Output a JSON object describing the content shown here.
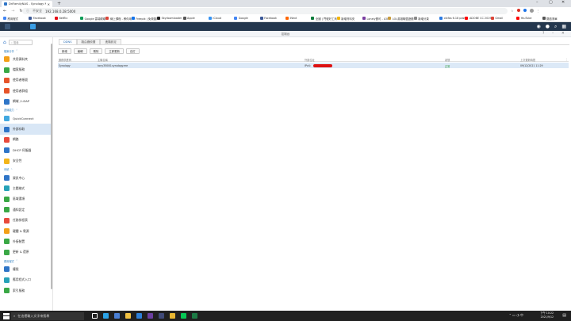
{
  "browser": {
    "tab_title": "DriFamilyNAS - Synology NAS",
    "new_tab": "+",
    "address_security": "不安全",
    "address_url": "192.168.0.28:5000",
    "bookmarks": [
      {
        "label": "應用程式",
        "color": "#4285f4"
      },
      {
        "label": "Facebook",
        "color": "#3b5998"
      },
      {
        "label": "Netflix",
        "color": "#e50914"
      },
      {
        "label": "Google 雲端硬碟",
        "color": "#0f9d58"
      },
      {
        "label": "線上課程 - 教你用...",
        "color": "#db4437"
      },
      {
        "label": "Freepik | 免費圖庫...",
        "color": "#1273eb"
      },
      {
        "label": "Skydownloader / T...",
        "color": "#222222"
      },
      {
        "label": "Apple",
        "color": "#555555"
      },
      {
        "label": "iCloud",
        "color": "#3693f3"
      },
      {
        "label": "Google",
        "color": "#4285f4"
      },
      {
        "label": "Facebook",
        "color": "#3b5998"
      },
      {
        "label": "iNext",
        "color": "#ff6600"
      },
      {
        "label": "全國 | 門號好工商...",
        "color": "#0a7d3b"
      },
      {
        "label": "新增資料夾",
        "color": "#f4b400"
      },
      {
        "label": "Lonely寶可 - LOL...",
        "color": "#7a3ea1"
      },
      {
        "label": "LOL英雄聯盟遊戲...",
        "color": "#c89b3c"
      },
      {
        "label": "新增分頁",
        "color": "#888888"
      },
      {
        "label": "cibfas 6.18 pass...",
        "color": "#2a7ae2"
      },
      {
        "label": "ADOBE CC 2019 f...",
        "color": "#ff0000"
      },
      {
        "label": "Gmail",
        "color": "#db4437"
      },
      {
        "label": "YouTube",
        "color": "#ff0000"
      },
      {
        "label": "閱讀清單",
        "color": "#555555"
      }
    ]
  },
  "window": {
    "title": "控制台"
  },
  "sidebar": {
    "search_placeholder": "搜尋",
    "groups": [
      {
        "label": "檔案分享",
        "items": [
          {
            "label": "共用資料夾",
            "color": "#f3a018",
            "name": "shared-folder"
          },
          {
            "label": "檔案服務",
            "color": "#3aa845",
            "name": "file-services"
          },
          {
            "label": "使用者帳號",
            "color": "#e6542a",
            "name": "user"
          },
          {
            "label": "使用者群組",
            "color": "#e6542a",
            "name": "group"
          },
          {
            "label": "網域 / LDAP",
            "color": "#2f75c7",
            "name": "domain-ldap"
          }
        ]
      },
      {
        "label": "連線能力",
        "items": [
          {
            "label": "QuickConnect",
            "color": "#40a8e0",
            "name": "quickconnect"
          },
          {
            "label": "外部存取",
            "color": "#2f75c7",
            "name": "external-access",
            "selected": true
          },
          {
            "label": "網路",
            "color": "#e84a3c",
            "name": "network"
          },
          {
            "label": "DHCP 伺服器",
            "color": "#2f75c7",
            "name": "dhcp-server"
          },
          {
            "label": "安全性",
            "color": "#f3b51a",
            "name": "security"
          }
        ]
      },
      {
        "label": "系統",
        "items": [
          {
            "label": "資訊中心",
            "color": "#2f75c7",
            "name": "info-center"
          },
          {
            "label": "主題樣式",
            "color": "#27a2b8",
            "name": "theme"
          },
          {
            "label": "區域選項",
            "color": "#3aa845",
            "name": "regional-options"
          },
          {
            "label": "通知設定",
            "color": "#3aa845",
            "name": "notification"
          },
          {
            "label": "任務排程表",
            "color": "#e84a3c",
            "name": "task-scheduler"
          },
          {
            "label": "硬體 & 電源",
            "color": "#f3a018",
            "name": "hardware-power"
          },
          {
            "label": "外接裝置",
            "color": "#3aa845",
            "name": "external-devices"
          },
          {
            "label": "更新 & 還原",
            "color": "#3aa845",
            "name": "update-restore"
          }
        ]
      },
      {
        "label": "應用程式",
        "items": [
          {
            "label": "權限",
            "color": "#2f75c7",
            "name": "privileges"
          },
          {
            "label": "應用程式入口",
            "color": "#27a2b8",
            "name": "application-portal"
          },
          {
            "label": "索引服務",
            "color": "#3aa845",
            "name": "indexing-service"
          }
        ]
      }
    ]
  },
  "main": {
    "tabs": [
      {
        "label": "DDNS",
        "active": true
      },
      {
        "label": "路由器設置",
        "active": false
      },
      {
        "label": "進階設定",
        "active": false
      }
    ],
    "toolbar": [
      "新增",
      "編輯",
      "刪除",
      "立即更新",
      "自訂"
    ],
    "columns": [
      "服務供應商",
      "主機名稱",
      "外部位址",
      "狀態",
      "上次更新時間"
    ],
    "rows": [
      {
        "provider": "Synology",
        "hostname": "tony35000.synology.me",
        "external": "IPv4:",
        "status": "正常",
        "updated": "09/12/2021 11:29"
      }
    ]
  },
  "taskbar": {
    "search_placeholder": "在這裡輸入文字來搜尋",
    "time": "下午 10:22",
    "date": "2021/9/12",
    "apps": [
      {
        "name": "task-view",
        "color": "#ffffff"
      },
      {
        "name": "edge",
        "color": "#2ba2e6"
      },
      {
        "name": "store",
        "color": "#4a7fd4"
      },
      {
        "name": "explorer",
        "color": "#f3c242"
      },
      {
        "name": "mail",
        "color": "#2d7fd8"
      },
      {
        "name": "app-purple",
        "color": "#6b3fa0"
      },
      {
        "name": "app-dark",
        "color": "#404a78"
      },
      {
        "name": "chrome",
        "color": "#e8b632"
      },
      {
        "name": "line",
        "color": "#06c755"
      },
      {
        "name": "excel",
        "color": "#1d7a45"
      }
    ]
  }
}
